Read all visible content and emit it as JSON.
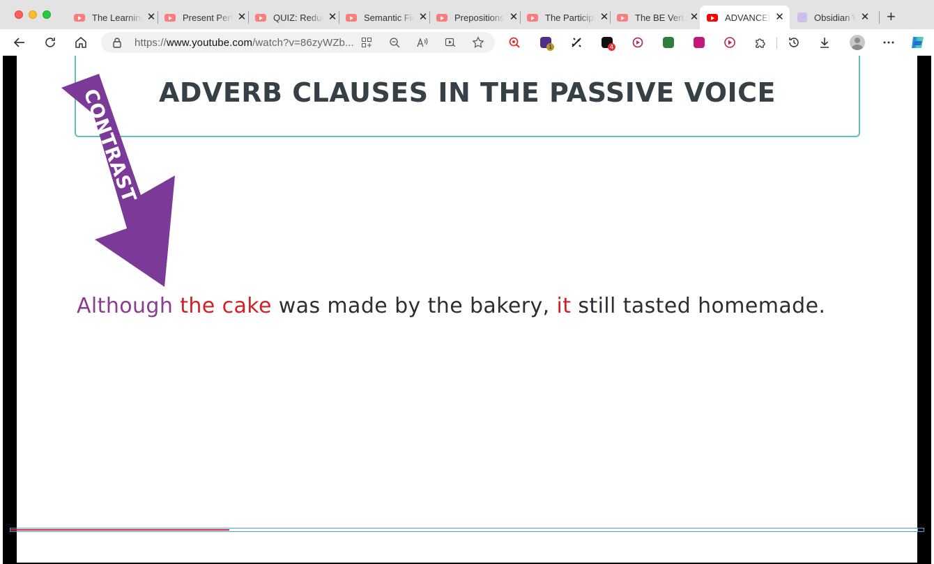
{
  "browser": {
    "tabs": [
      {
        "label": "The Learning",
        "icon": "youtube-icon"
      },
      {
        "label": "Present Perfect",
        "icon": "youtube-icon"
      },
      {
        "label": "QUIZ: Reduced",
        "icon": "youtube-icon"
      },
      {
        "label": "Semantic Fields",
        "icon": "youtube-icon"
      },
      {
        "label": "Prepositions",
        "icon": "youtube-icon"
      },
      {
        "label": "The Participle",
        "icon": "youtube-icon"
      },
      {
        "label": "The BE Verb",
        "icon": "youtube-icon"
      },
      {
        "label": "ADVANCED",
        "icon": "youtube-icon",
        "active": true
      },
      {
        "label": "Obsidian Web",
        "icon": "obsidian-icon"
      }
    ],
    "close_glyph": "✕",
    "new_tab_glyph": "+",
    "url_prefix": "https://",
    "url_host": "www.youtube.com",
    "url_path": "/watch?v=86zyWZb...",
    "extension_badges": {
      "first": "1",
      "second": "4"
    },
    "colors": {
      "tab_strip": "#e3e3e3",
      "youtube_red": "#ff0000",
      "accent_teal": "#5bc2b8"
    }
  },
  "slide": {
    "heading": "ADVERB CLAUSES IN THE PASSIVE VOICE",
    "arrow_label": "CONTRAST",
    "sentence": {
      "w1": "Although",
      "w2": "the cake",
      "w3": "was made by the bakery,",
      "w4": "it",
      "w5": "still tasted homemade."
    }
  },
  "player": {
    "progress_fraction": 0.24
  }
}
